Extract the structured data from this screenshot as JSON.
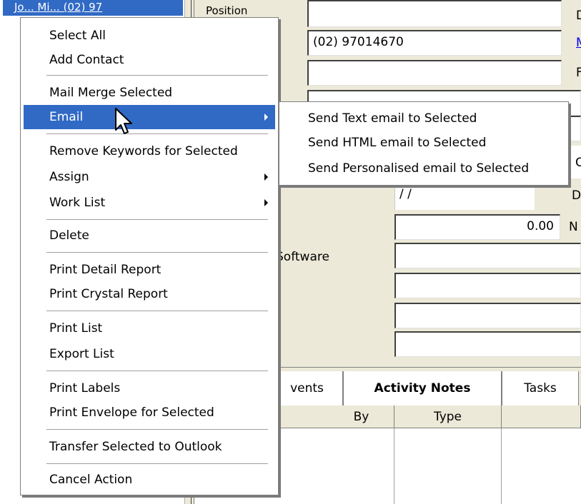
{
  "background": {
    "list_selected_row": "Jo... Mi...        (02) 97",
    "form": {
      "position_label": "Position",
      "phone_value": "(02) 97014670",
      "date_value": "/ /",
      "amount_value": "0.00",
      "software_label": "Software",
      "right_label_d1": "D",
      "right_label_m": "M",
      "right_label_f": "F",
      "right_label_c": "C",
      "right_label_d2": "D",
      "right_label_n": "N"
    },
    "tabs": {
      "events": "vents",
      "activity_notes": "Activity Notes",
      "tasks": "Tasks"
    },
    "grid_headers": {
      "by": "By",
      "type": "Type"
    }
  },
  "context_menu": {
    "items": [
      {
        "label": "Select All"
      },
      {
        "label": "Add Contact"
      },
      {
        "label": "Mail Merge Selected"
      },
      {
        "label": "Email"
      },
      {
        "label": "Remove Keywords for Selected"
      },
      {
        "label": "Assign"
      },
      {
        "label": "Work List"
      },
      {
        "label": "Delete"
      },
      {
        "label": "Print Detail Report"
      },
      {
        "label": "Print Crystal Report"
      },
      {
        "label": "Print List"
      },
      {
        "label": "Export List"
      },
      {
        "label": "Print Labels"
      },
      {
        "label": "Print Envelope for Selected"
      },
      {
        "label": "Transfer Selected to Outlook"
      },
      {
        "label": "Cancel Action"
      }
    ],
    "highlighted_item": "Email"
  },
  "email_submenu": {
    "items": [
      {
        "label": "Send Text email to Selected"
      },
      {
        "label": "Send HTML email to Selected"
      },
      {
        "label": "Send Personalised email to Selected"
      }
    ]
  },
  "colors": {
    "highlight": "#316ac5",
    "window_bg": "#ece9d8"
  }
}
